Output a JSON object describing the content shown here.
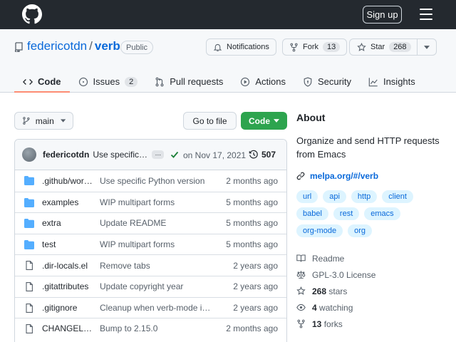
{
  "header": {
    "signin_label": "Sign up"
  },
  "repo": {
    "owner": "federicotdn",
    "separator": "/",
    "name": "verb",
    "visibility": "Public",
    "notifications_label": "Notifications",
    "fork_label": "Fork",
    "fork_count": "13",
    "star_label": "Star",
    "star_count": "268"
  },
  "tabs": [
    {
      "label": "Code",
      "icon": "code-icon",
      "active": true
    },
    {
      "label": "Issues",
      "icon": "issue-icon",
      "count": "2"
    },
    {
      "label": "Pull requests",
      "icon": "pull-request-icon"
    },
    {
      "label": "Actions",
      "icon": "play-icon"
    },
    {
      "label": "Security",
      "icon": "shield-icon"
    },
    {
      "label": "Insights",
      "icon": "graph-icon"
    }
  ],
  "toolbar": {
    "branch": "main",
    "goto_file": "Go to file",
    "code_label": "Code"
  },
  "commit": {
    "author": "federicotdn",
    "message": "Use specific Python version",
    "ellipsis": "…",
    "date": "on Nov 17, 2021",
    "commits": "507"
  },
  "files": [
    {
      "type": "dir",
      "name": ".github/workflows",
      "message": "Use specific Python version",
      "age": "2 months ago"
    },
    {
      "type": "dir",
      "name": "examples",
      "message": "WIP multipart forms",
      "age": "5 months ago"
    },
    {
      "type": "dir",
      "name": "extra",
      "message": "Update README",
      "age": "5 months ago"
    },
    {
      "type": "dir",
      "name": "test",
      "message": "WIP multipart forms",
      "age": "5 months ago"
    },
    {
      "type": "file",
      "name": ".dir-locals.el",
      "message": "Remove tabs",
      "age": "2 years ago"
    },
    {
      "type": "file",
      "name": ".gitattributes",
      "message": "Update copyright year",
      "age": "2 years ago"
    },
    {
      "type": "file",
      "name": ".gitignore",
      "message": "Cleanup when verb-mode is disabled",
      "age": "2 years ago"
    },
    {
      "type": "file",
      "name": "CHANGELOG.md",
      "message": "Bump to 2.15.0",
      "age": "2 months ago"
    }
  ],
  "about": {
    "title": "About",
    "description": "Organize and send HTTP requests from Emacs",
    "link": "melpa.org/#/verb",
    "topics": [
      "url",
      "api",
      "http",
      "client",
      "babel",
      "rest",
      "emacs",
      "org-mode",
      "org"
    ],
    "readme": "Readme",
    "license": "GPL-3.0 License",
    "stars_count": "268",
    "stars_label": "stars",
    "watching_count": "4",
    "watching_label": "watching",
    "forks_count": "13",
    "forks_label": "forks"
  },
  "colors": {
    "header_bg": "#24292f",
    "link": "#0969da",
    "code_button": "#2da44e",
    "active_tab_underline": "#fd8c73",
    "topic_bg": "#ddf4ff"
  }
}
